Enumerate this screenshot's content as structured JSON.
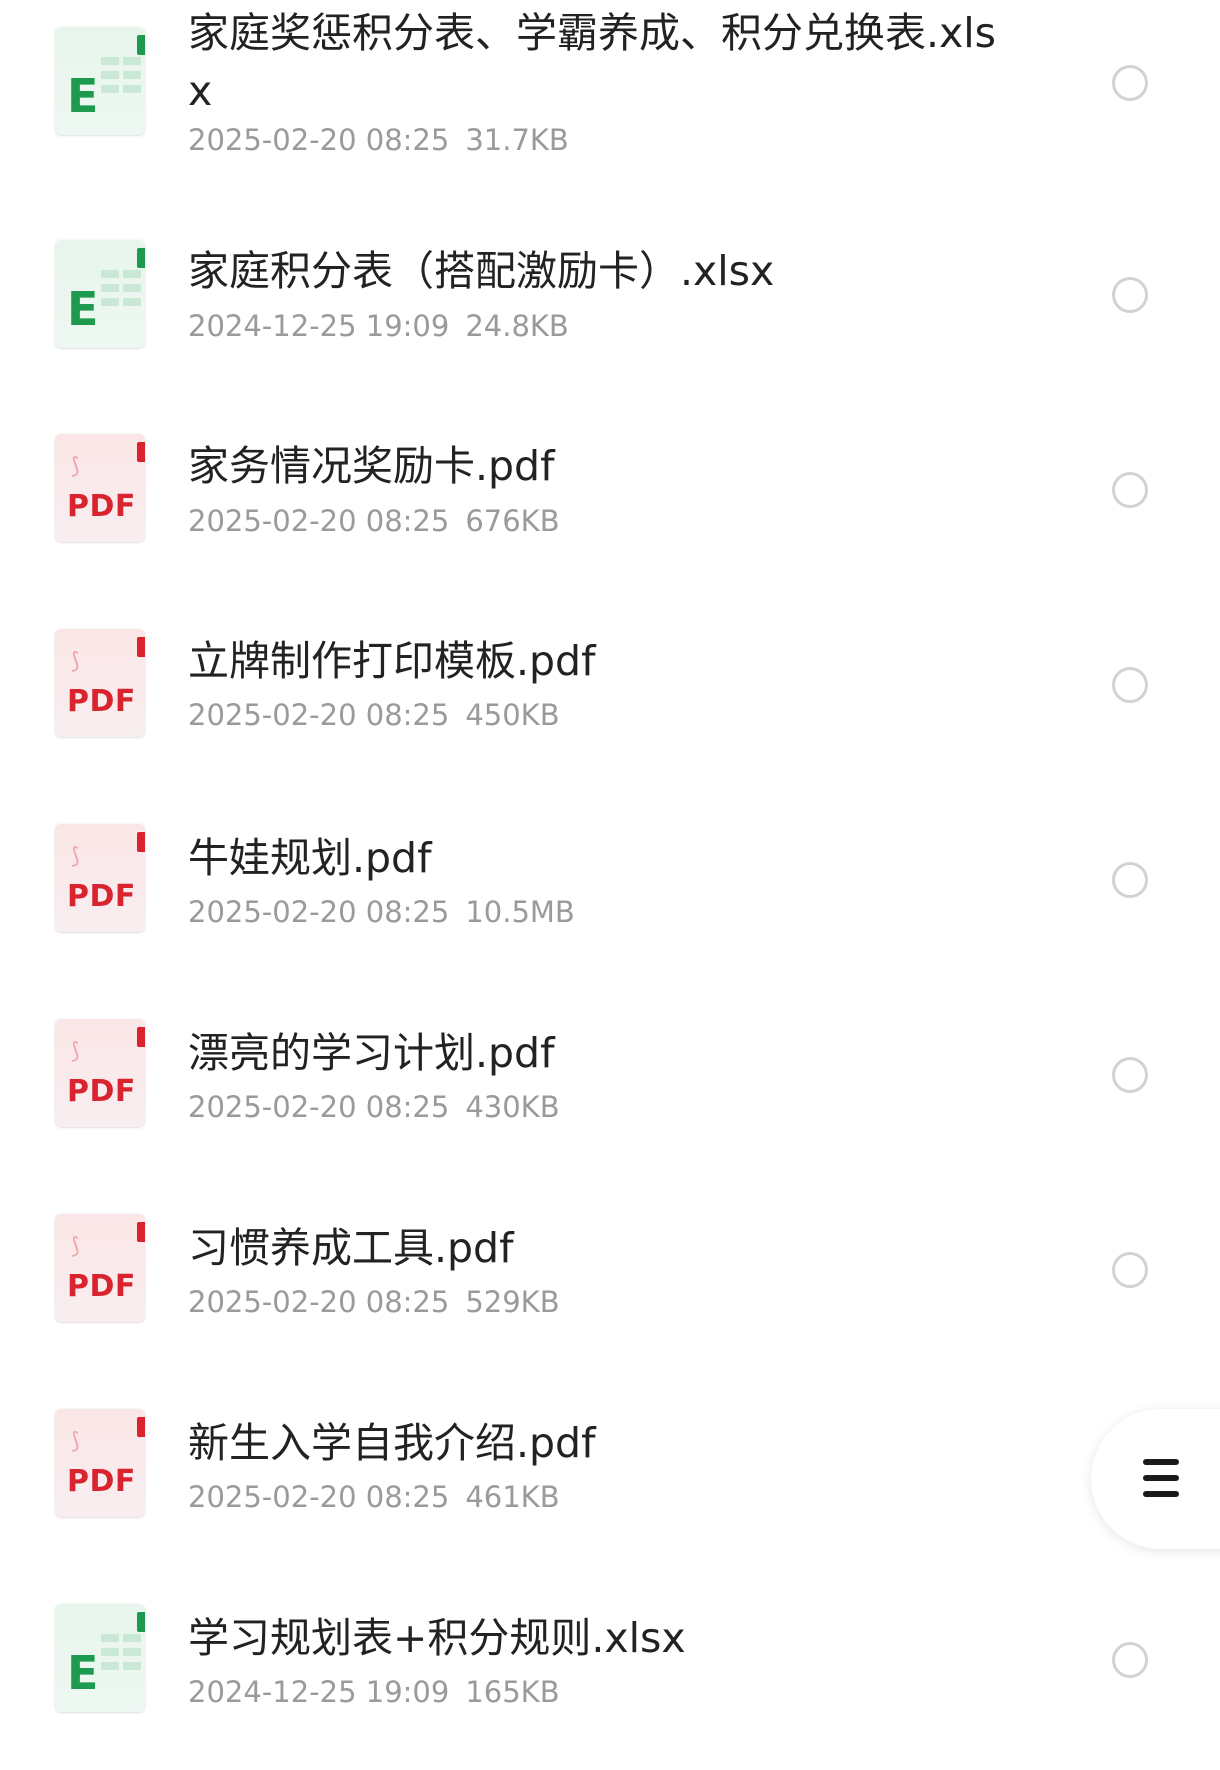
{
  "files": [
    {
      "name": "家庭奖惩积分表、学霸养成、积分兑换表.xlsx",
      "type": "xlsx",
      "date": "2025-02-20 08:25",
      "size": "31.7KB"
    },
    {
      "name": "家庭积分表（搭配激励卡）.xlsx",
      "type": "xlsx",
      "date": "2024-12-25 19:09",
      "size": "24.8KB"
    },
    {
      "name": "家务情况奖励卡.pdf",
      "type": "pdf",
      "date": "2025-02-20 08:25",
      "size": "676KB"
    },
    {
      "name": "立牌制作打印模板.pdf",
      "type": "pdf",
      "date": "2025-02-20 08:25",
      "size": "450KB"
    },
    {
      "name": "牛娃规划.pdf",
      "type": "pdf",
      "date": "2025-02-20 08:25",
      "size": "10.5MB"
    },
    {
      "name": "漂亮的学习计划.pdf",
      "type": "pdf",
      "date": "2025-02-20 08:25",
      "size": "430KB"
    },
    {
      "name": "习惯养成工具.pdf",
      "type": "pdf",
      "date": "2025-02-20 08:25",
      "size": "529KB"
    },
    {
      "name": "新生入学自我介绍.pdf",
      "type": "pdf",
      "date": "2025-02-20 08:25",
      "size": "461KB"
    },
    {
      "name": "学习规划表+积分规则.xlsx",
      "type": "xlsx",
      "date": "2024-12-25 19:09",
      "size": "165KB"
    }
  ],
  "icons": {
    "xlsx": {
      "glyph": "E",
      "name": "excel-file-icon",
      "color": "#1d9a4d"
    },
    "pdf": {
      "glyph": "PDF",
      "name": "pdf-file-icon",
      "color": "#d9232e"
    }
  },
  "selection_icon": "radio-unchecked-icon",
  "menu_button": {
    "icon": "hamburger-menu-icon"
  }
}
